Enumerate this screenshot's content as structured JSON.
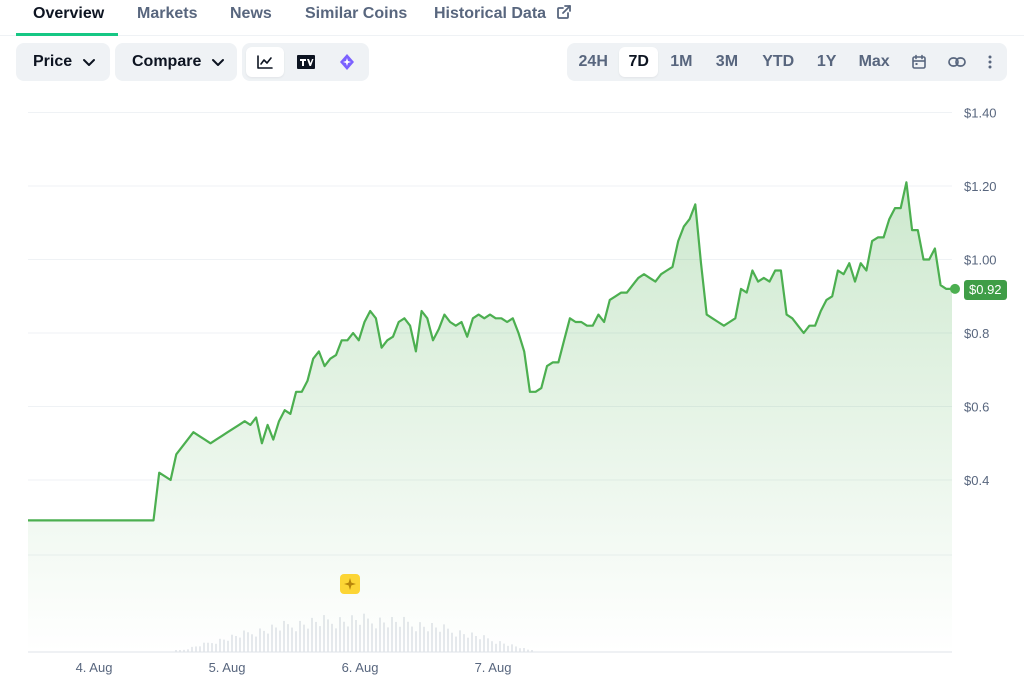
{
  "tabs": [
    {
      "label": "Overview",
      "active": true
    },
    {
      "label": "Markets"
    },
    {
      "label": "News"
    },
    {
      "label": "Similar Coins"
    },
    {
      "label": "Historical Data",
      "icon": "external-link-icon"
    }
  ],
  "toolbar": {
    "price_label": "Price",
    "compare_label": "Compare",
    "view_icons": [
      "line-chart-icon",
      "tradingview-icon",
      "ai-icon"
    ],
    "ranges": [
      "24H",
      "7D",
      "1M",
      "3M",
      "YTD",
      "1Y",
      "Max"
    ],
    "active_range": "7D",
    "extra_icons": [
      "calendar-icon",
      "link-icon",
      "more-icon"
    ]
  },
  "colors": {
    "line": "#4caf50",
    "badge": "#3f9d47",
    "active_tab_underline": "#16c784",
    "ai_badge": "#fcd535"
  },
  "price_badge": "$0.92",
  "chart_data": {
    "type": "area",
    "x_ticks": [
      "4. Aug",
      "5. Aug",
      "6. Aug",
      "7. Aug"
    ],
    "y_ticks": [
      "$0.4",
      "$0.6",
      "$0.8",
      "$1.00",
      "$1.20",
      "$1.40"
    ],
    "ylim": [
      0.2,
      1.5
    ],
    "grid": true,
    "series": [
      {
        "values": [
          0.29,
          0.29,
          0.29,
          0.29,
          0.29,
          0.29,
          0.29,
          0.29,
          0.29,
          0.29,
          0.29,
          0.29,
          0.29,
          0.29,
          0.29,
          0.29,
          0.29,
          0.29,
          0.29,
          0.29,
          0.29,
          0.29,
          0.29,
          0.42,
          0.41,
          0.4,
          0.47,
          0.49,
          0.51,
          0.53,
          0.52,
          0.51,
          0.5,
          0.51,
          0.52,
          0.53,
          0.54,
          0.55,
          0.56,
          0.55,
          0.57,
          0.5,
          0.55,
          0.51,
          0.56,
          0.59,
          0.58,
          0.64,
          0.64,
          0.67,
          0.73,
          0.75,
          0.71,
          0.73,
          0.74,
          0.78,
          0.78,
          0.8,
          0.78,
          0.83,
          0.86,
          0.84,
          0.76,
          0.78,
          0.79,
          0.83,
          0.84,
          0.82,
          0.75,
          0.86,
          0.84,
          0.78,
          0.81,
          0.85,
          0.83,
          0.82,
          0.83,
          0.79,
          0.84,
          0.85,
          0.84,
          0.85,
          0.84,
          0.84,
          0.83,
          0.84,
          0.8,
          0.75,
          0.64,
          0.64,
          0.65,
          0.71,
          0.72,
          0.72,
          0.78,
          0.84,
          0.83,
          0.83,
          0.82,
          0.82,
          0.85,
          0.83,
          0.89,
          0.9,
          0.91,
          0.91,
          0.93,
          0.95,
          0.96,
          0.95,
          0.94,
          0.96,
          0.97,
          0.98,
          1.05,
          1.09,
          1.11,
          1.15,
          0.99,
          0.85,
          0.84,
          0.83,
          0.82,
          0.83,
          0.84,
          0.92,
          0.91,
          0.97,
          0.94,
          0.95,
          0.94,
          0.97,
          0.97,
          0.85,
          0.84,
          0.82,
          0.8,
          0.82,
          0.82,
          0.86,
          0.89,
          0.9,
          0.97,
          0.96,
          0.99,
          0.94,
          0.99,
          0.97,
          1.05,
          1.06,
          1.06,
          1.11,
          1.14,
          1.14,
          1.21,
          1.08,
          1.08,
          1.0,
          1.0,
          1.03,
          0.93,
          0.92,
          0.92
        ]
      }
    ]
  }
}
